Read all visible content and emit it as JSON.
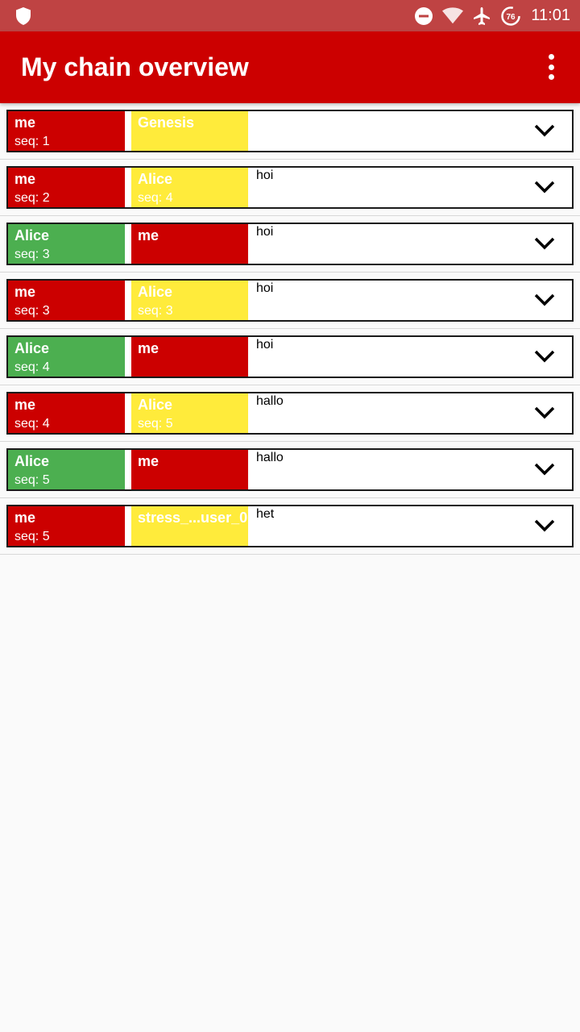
{
  "status_bar": {
    "time": "11:01",
    "battery_level": "76",
    "icons": [
      "shield-icon",
      "do-not-disturb-icon",
      "wifi-icon",
      "airplane-mode-icon",
      "battery-saver-icon"
    ]
  },
  "app_bar": {
    "title": "My chain overview",
    "menu_icon": "more-vert-icon"
  },
  "colors": {
    "status_bar": "#bf4343",
    "app_bar": "#cc0000",
    "block_me": "#cc0000",
    "block_peer": "#4caf50",
    "block_pending": "#ffeb3b"
  },
  "blocks": [
    {
      "from": {
        "name": "me",
        "seq": "seq: 1",
        "color": "red"
      },
      "to": {
        "name": "Genesis",
        "seq": "",
        "color": "yellow"
      },
      "message": ""
    },
    {
      "from": {
        "name": "me",
        "seq": "seq: 2",
        "color": "red"
      },
      "to": {
        "name": "Alice",
        "seq": "seq: 4",
        "color": "yellow"
      },
      "message": "hoi"
    },
    {
      "from": {
        "name": "Alice",
        "seq": "seq: 3",
        "color": "green"
      },
      "to": {
        "name": "me",
        "seq": "",
        "color": "red"
      },
      "message": "hoi"
    },
    {
      "from": {
        "name": "me",
        "seq": "seq: 3",
        "color": "red"
      },
      "to": {
        "name": "Alice",
        "seq": "seq: 3",
        "color": "yellow"
      },
      "message": "hoi"
    },
    {
      "from": {
        "name": "Alice",
        "seq": "seq: 4",
        "color": "green"
      },
      "to": {
        "name": "me",
        "seq": "",
        "color": "red"
      },
      "message": "hoi"
    },
    {
      "from": {
        "name": "me",
        "seq": "seq: 4",
        "color": "red"
      },
      "to": {
        "name": "Alice",
        "seq": "seq: 5",
        "color": "yellow"
      },
      "message": "hallo"
    },
    {
      "from": {
        "name": "Alice",
        "seq": "seq: 5",
        "color": "green"
      },
      "to": {
        "name": "me",
        "seq": "",
        "color": "red"
      },
      "message": "hallo"
    },
    {
      "from": {
        "name": "me",
        "seq": "seq: 5",
        "color": "red"
      },
      "to": {
        "name": "stress_...user_0",
        "seq": "",
        "color": "yellow"
      },
      "message": "het"
    }
  ]
}
